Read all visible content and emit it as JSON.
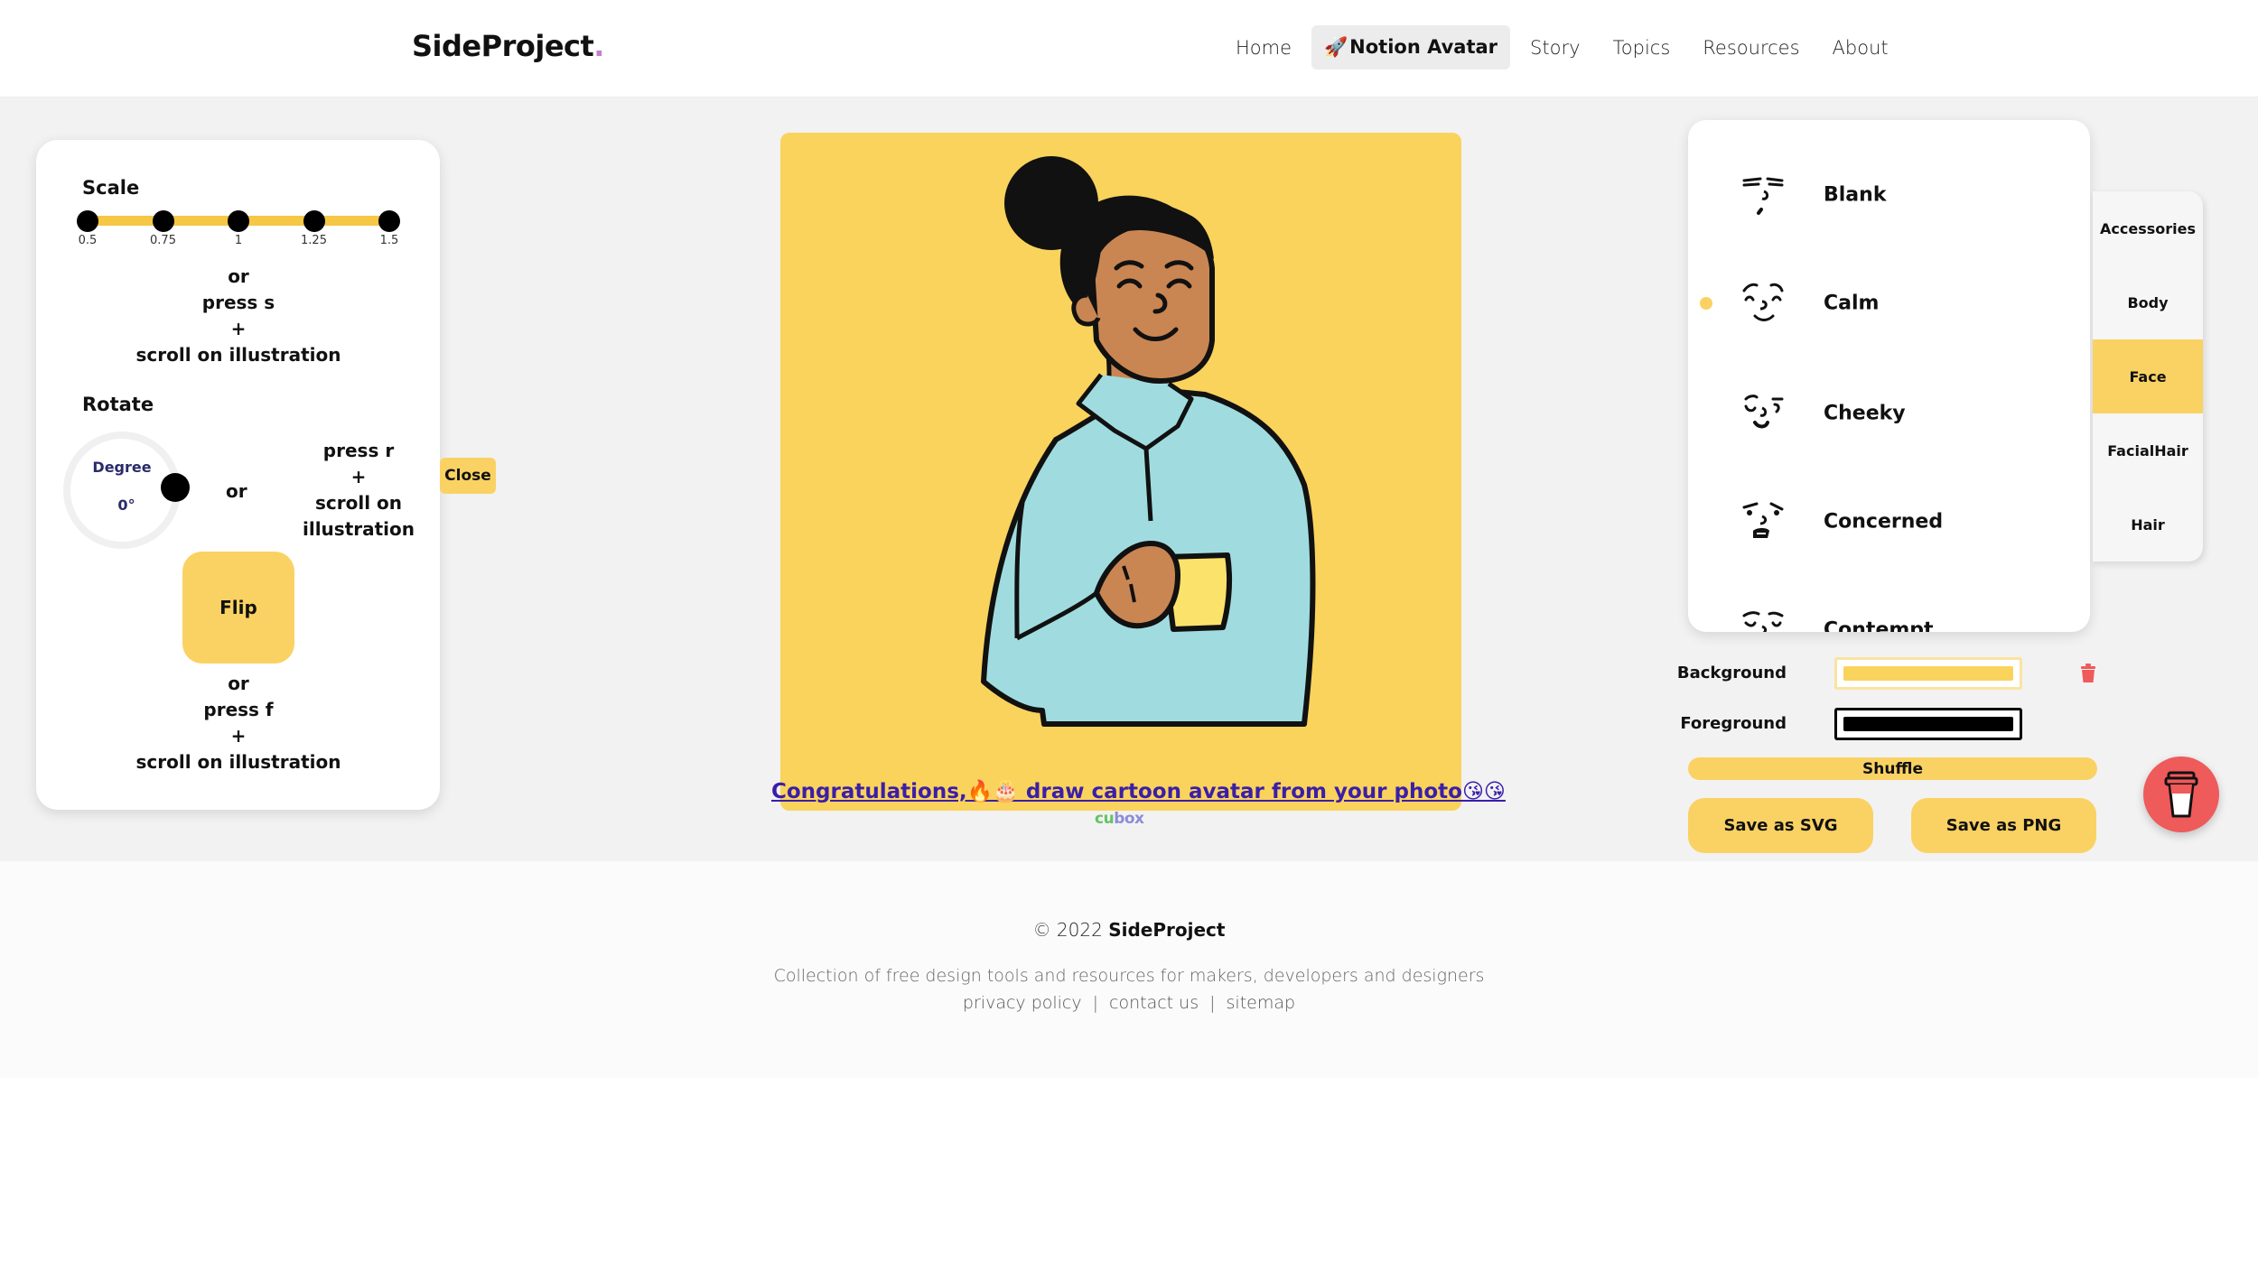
{
  "header": {
    "logo": "SideProject",
    "logo_dot": ".",
    "nav": [
      {
        "label": "Home",
        "active": false
      },
      {
        "label": "Notion Avatar",
        "icon": "🚀",
        "active": true
      },
      {
        "label": "Story",
        "active": false
      },
      {
        "label": "Topics",
        "active": false
      },
      {
        "label": "Resources",
        "active": false
      },
      {
        "label": "About",
        "active": false
      }
    ]
  },
  "controls": {
    "scale": {
      "title": "Scale",
      "ticks": [
        "0.5",
        "0.75",
        "1",
        "1.25",
        "1.5"
      ],
      "hint": [
        "or",
        "press s",
        "+",
        "scroll on illustration"
      ]
    },
    "rotate": {
      "title": "Rotate",
      "dial_label": "Degree",
      "value": "0°",
      "or": "or",
      "hint": [
        "press r",
        "+",
        "scroll on",
        "illustration"
      ]
    },
    "close_label": "Close",
    "flip": {
      "label": "Flip",
      "hint": [
        "or",
        "press f",
        "+",
        "scroll on illustration"
      ]
    }
  },
  "avatar": {
    "background": "#fad35c",
    "skin": "#c98652",
    "shirt": "#a0dcdf",
    "mug": "#fbe36b",
    "outline": "#111111"
  },
  "promo": {
    "text": "Congratulations,🔥🎂 draw cartoon avatar from your photo😘😘",
    "brand_part1": "cu",
    "brand_part2": "box"
  },
  "face_panel": {
    "items": [
      {
        "label": "Blank",
        "selected": false
      },
      {
        "label": "Calm",
        "selected": true
      },
      {
        "label": "Cheeky",
        "selected": false
      },
      {
        "label": "Concerned",
        "selected": false
      },
      {
        "label": "Contempt",
        "selected": false
      }
    ]
  },
  "categories": [
    {
      "label": "Accessories",
      "active": false
    },
    {
      "label": "Body",
      "active": false
    },
    {
      "label": "Face",
      "active": true
    },
    {
      "label": "FacialHair",
      "active": false
    },
    {
      "label": "Hair",
      "active": false
    }
  ],
  "colors": {
    "background_label": "Background",
    "background_value": "#fad35c",
    "foreground_label": "Foreground",
    "foreground_value": "#000000"
  },
  "actions": {
    "shuffle": "Shuffle",
    "save_svg": "Save as SVG",
    "save_png": "Save as PNG"
  },
  "footer": {
    "copyright_prefix": "© 2022 ",
    "copyright_brand": "SideProject",
    "tagline": "Collection of free design tools and resources for makers, developers and designers",
    "links": [
      "privacy policy",
      "contact us",
      "sitemap"
    ],
    "separator": "|"
  }
}
